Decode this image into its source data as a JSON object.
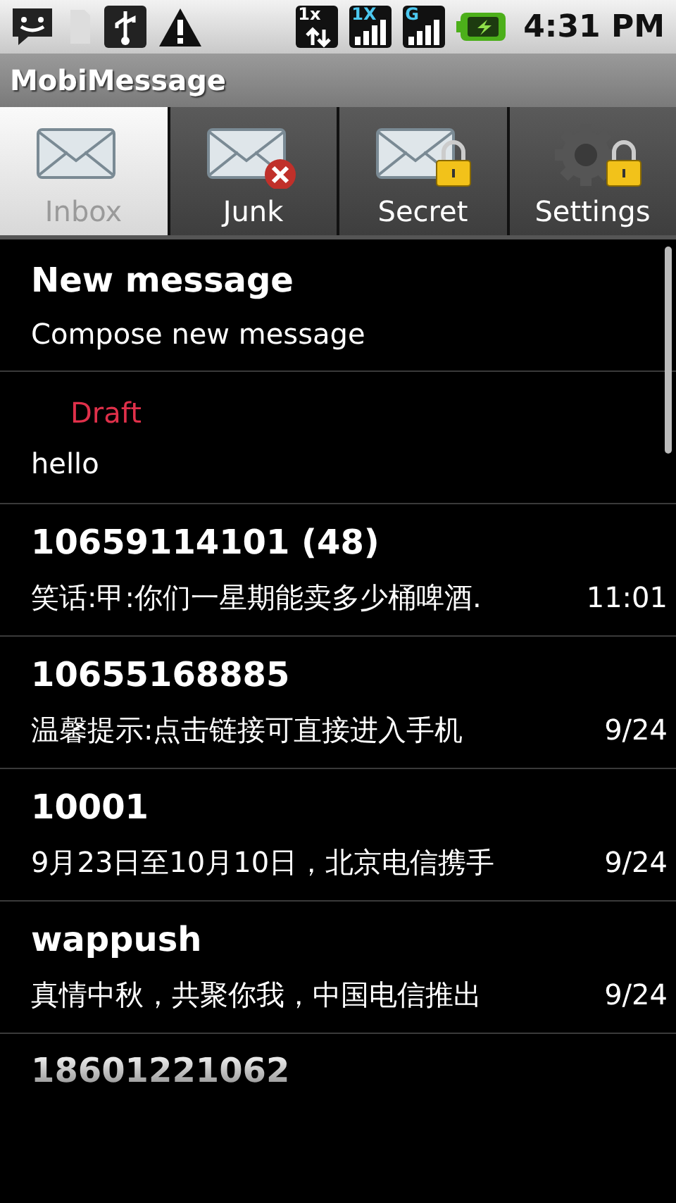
{
  "status_bar": {
    "network_labels": [
      "1x",
      "1X",
      "G"
    ],
    "time": "4:31 PM"
  },
  "app_title": "MobiMessage",
  "tabs": [
    {
      "label": "Inbox",
      "kind": "mail",
      "selected": true
    },
    {
      "label": "Junk",
      "kind": "junk",
      "selected": false
    },
    {
      "label": "Secret",
      "kind": "secret",
      "selected": false
    },
    {
      "label": "Settings",
      "kind": "settings",
      "selected": false
    }
  ],
  "messages": [
    {
      "kind": "compose",
      "title": "New message",
      "subtitle": "Compose new message"
    },
    {
      "kind": "draft",
      "badge": "Draft",
      "preview": "hello"
    },
    {
      "kind": "thread",
      "sender": "10659114101 (48)",
      "preview": "笑话:甲:你们一星期能卖多少桶啤酒.",
      "time": "11:01"
    },
    {
      "kind": "thread",
      "sender": "10655168885",
      "preview": "温馨提示:点击链接可直接进入手机",
      "time": "9/24"
    },
    {
      "kind": "thread",
      "sender": "10001",
      "preview": "9月23日至10月10日，北京电信携手",
      "time": "9/24"
    },
    {
      "kind": "thread",
      "sender": "wappush",
      "preview": "真情中秋，共聚你我，中国电信推出",
      "time": "9/24"
    },
    {
      "kind": "partial",
      "sender": "18601221062"
    }
  ]
}
